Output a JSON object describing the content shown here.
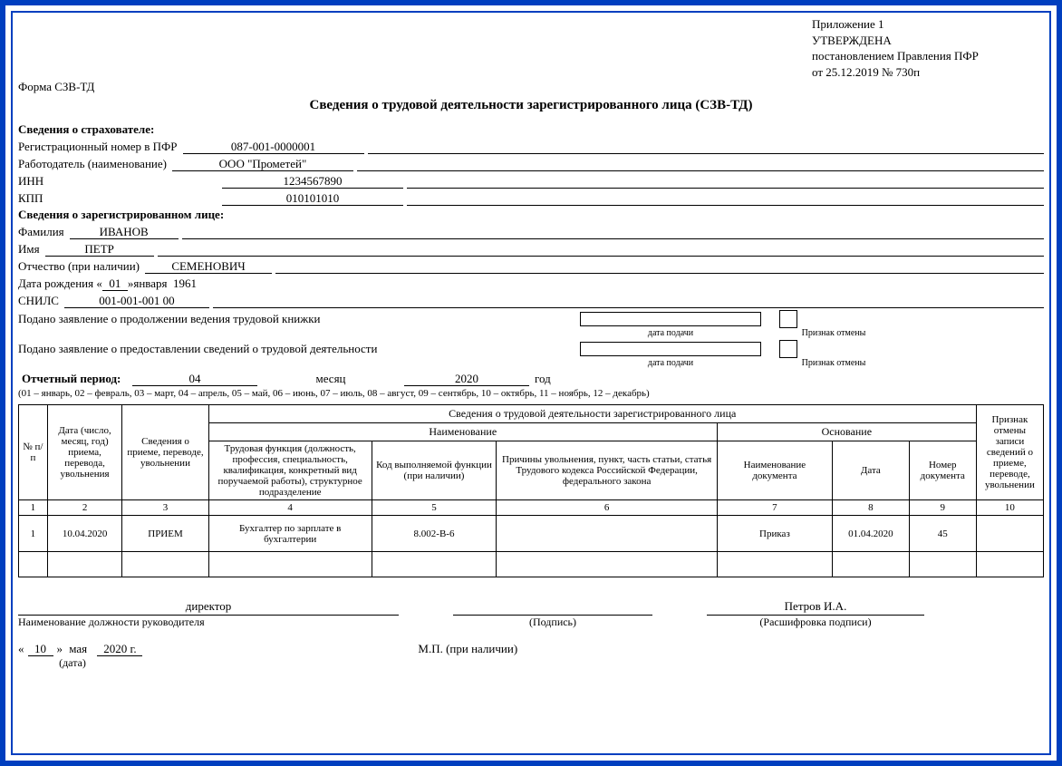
{
  "approval": {
    "l1": "Приложение 1",
    "l2": "УТВЕРЖДЕНА",
    "l3": "постановлением Правления ПФР",
    "l4": "от 25.12.2019   № 730п"
  },
  "form_code": "Форма СЗВ-ТД",
  "title": "Сведения о трудовой деятельности зарегистрированного лица (СЗВ-ТД)",
  "insurer": {
    "head": "Сведения о страхователе:",
    "reg_label": "Регистрационный номер в ПФР",
    "reg_value": "087-001-0000001",
    "employer_label": "Работодатель (наименование)",
    "employer_value": "ООО \"Прометей\"",
    "inn_label": "ИНН",
    "inn_value": "1234567890",
    "kpp_label": "КПП",
    "kpp_value": "010101010"
  },
  "person": {
    "head": "Сведения о зарегистрированном лице:",
    "surname_label": "Фамилия",
    "surname_value": "ИВАНОВ",
    "name_label": "Имя",
    "name_value": "ПЕТР",
    "patr_label": "Отчество (при наличии)",
    "patr_value": "СЕМЕНОВИЧ",
    "dob_prefix": "Дата рождения «",
    "dob_day": "01",
    "dob_mid": "» ",
    "dob_month": "января",
    "dob_year": "1961",
    "snils_label": "СНИЛС",
    "snils_value": "001-001-001 00"
  },
  "statements": {
    "s1": "Подано заявление о продолжении ведения трудовой книжки",
    "s2": "Подано заявление о предоставлении сведений о трудовой деятельности",
    "sub_date": "дата подачи",
    "sub_sign": "Признак отмены"
  },
  "period": {
    "label": "Отчетный период:",
    "month_value": "04",
    "month_label": "месяц",
    "year_value": "2020",
    "year_label": "год",
    "note": "(01 – январь, 02 – февраль, 03 – март, 04 – апрель, 05 – май, 06 – июнь, 07 – июль, 08 – август, 09 – сентябрь, 10 – октябрь, 11 – ноябрь, 12 – декабрь)"
  },
  "activity_table": {
    "top_header": "Сведения о трудовой деятельности зарегистрированного лица",
    "col_num": "№ п/п",
    "col_date": "Дата (число, месяц, год) приема, перевода, увольнения",
    "col_info": "Сведения о приеме, переводе, увольнении",
    "col_naming": "Наименование",
    "col_func": "Трудовая функция (должность, профессия, специальность, квалификация, конкретный вид поручаемой работы), структурное подразделение",
    "col_code": "Код выполняемой функции (при наличии)",
    "col_reason": "Причины увольнения, пункт, часть статьи, статья Трудового кодекса Российской Федерации, федерального закона",
    "col_basis": "Основание",
    "col_doc": "Наименование документа",
    "col_doc_date": "Дата",
    "col_doc_num": "Номер документа",
    "col_cancel": "Признак отмены записи сведений о приеме, переводе, увольнении",
    "nums": {
      "1": "1",
      "2": "2",
      "3": "3",
      "4": "4",
      "5": "5",
      "6": "6",
      "7": "7",
      "8": "8",
      "9": "9",
      "10": "10"
    },
    "row1": {
      "num": "1",
      "date": "10.04.2020",
      "action": "ПРИЕМ",
      "func": "Бухгалтер по зарплате в бухгалтерии",
      "code": "8.002-В-6",
      "reason": "",
      "doc": "Приказ",
      "doc_date": "01.04.2020",
      "doc_num": "45",
      "cancel": ""
    }
  },
  "signatures": {
    "director": "директор",
    "pos_label": "Наименование должности руководителя",
    "sign_label": "(Подпись)",
    "name": "Петров И.А.",
    "name_label": "(Расшифровка подписи)",
    "date_day": "10",
    "date_month": "мая",
    "date_year_suffix": "2020 г.",
    "date_label": "(дата)",
    "mp": "М.П. (при наличии)"
  }
}
